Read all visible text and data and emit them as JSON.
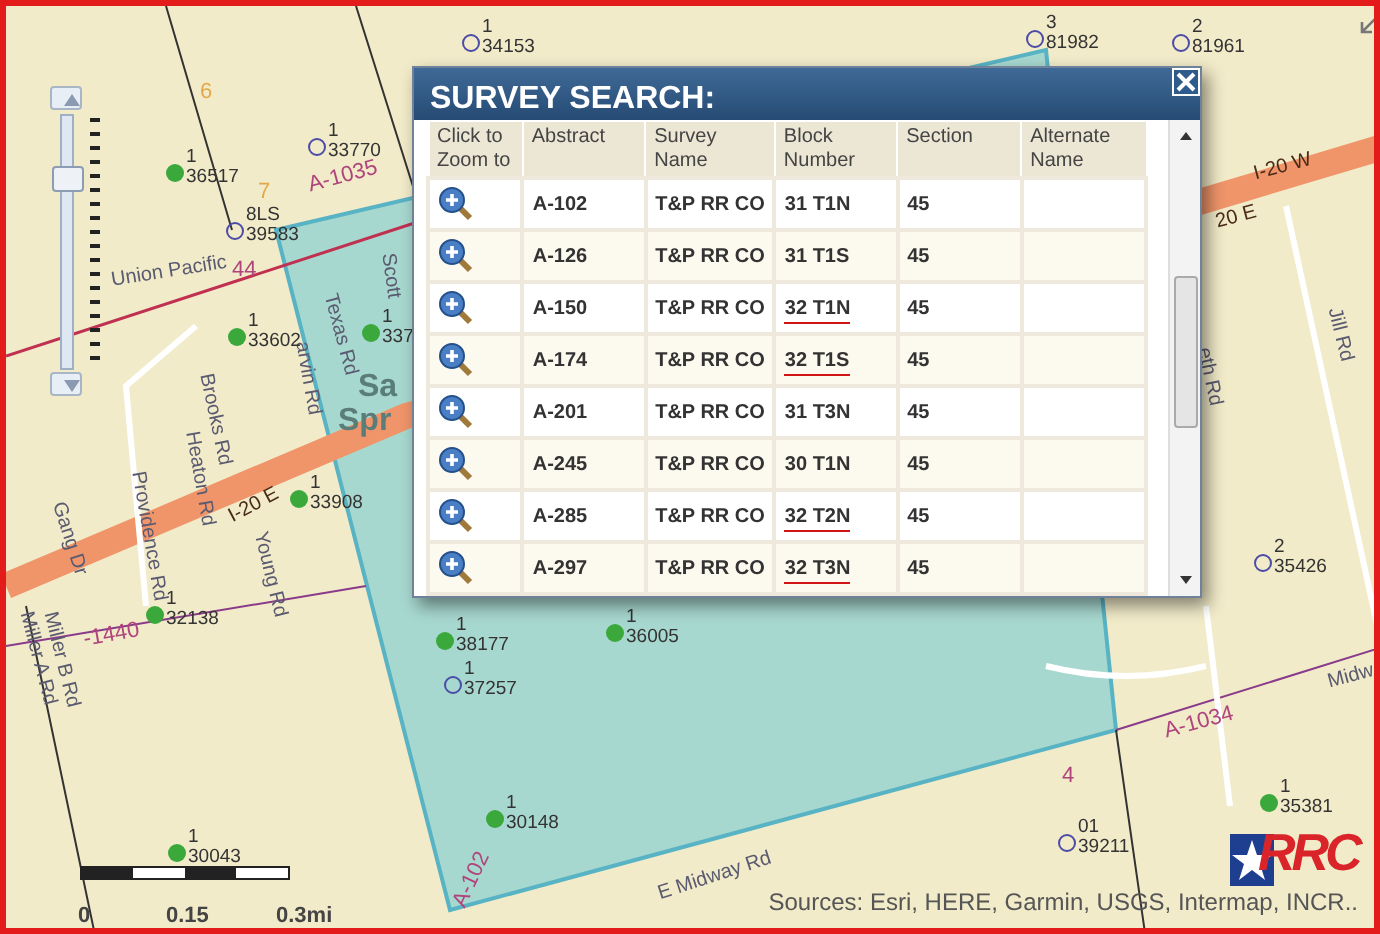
{
  "map": {
    "roads": [
      {
        "text": "Union Pacific"
      },
      {
        "text": "Providence Rd"
      },
      {
        "text": "Heaton Rd"
      },
      {
        "text": "Brooks Rd"
      },
      {
        "text": "Texas Rd"
      },
      {
        "text": "Scott"
      },
      {
        "text": "Gang Dr"
      },
      {
        "text": "Miller B Rd"
      },
      {
        "text": "Miller A Rd"
      },
      {
        "text": "Young Rd"
      },
      {
        "text": "I-20 E"
      },
      {
        "text": "I-20 W"
      },
      {
        "text": "20 E"
      },
      {
        "text": "Jill Rd"
      },
      {
        "text": "E Midway Rd"
      },
      {
        "text": "Midw"
      },
      {
        "text": "arvin Rd"
      },
      {
        "text": "eth Rd"
      }
    ],
    "places": [
      {
        "text": "Sa"
      },
      {
        "text": "Spr"
      }
    ],
    "tract_labels": [
      {
        "text": "A-1035",
        "kind": "abstract"
      },
      {
        "text": "A-1034",
        "kind": "abstract"
      },
      {
        "text": "-1440",
        "kind": "abstract"
      },
      {
        "text": "A-102",
        "kind": "abstract"
      },
      {
        "text": "44",
        "kind": "abstract"
      },
      {
        "text": "4",
        "kind": "abstract"
      },
      {
        "text": "6",
        "kind": "section"
      },
      {
        "text": "7",
        "kind": "section"
      }
    ],
    "wells": [
      {
        "kind": "producing",
        "number": "1",
        "id": "36517"
      },
      {
        "kind": "permit",
        "number": "1",
        "id": "33770"
      },
      {
        "kind": "permit",
        "number": "8LS",
        "id": "39583"
      },
      {
        "kind": "producing",
        "number": "1",
        "id": "33602"
      },
      {
        "kind": "producing",
        "number": "1",
        "id": "337"
      },
      {
        "kind": "producing",
        "number": "1",
        "id": "33908"
      },
      {
        "kind": "producing",
        "number": "1",
        "id": "32138"
      },
      {
        "kind": "producing",
        "number": "1",
        "id": "38177"
      },
      {
        "kind": "permit",
        "number": "1",
        "id": "37257"
      },
      {
        "kind": "producing",
        "number": "1",
        "id": "36005"
      },
      {
        "kind": "producing",
        "number": "1",
        "id": "30148"
      },
      {
        "kind": "producing",
        "number": "1",
        "id": "30043"
      },
      {
        "kind": "permit",
        "number": "01",
        "id": "39211"
      },
      {
        "kind": "producing",
        "number": "1",
        "id": "35381"
      },
      {
        "kind": "permit",
        "number": "2",
        "id": "35426"
      },
      {
        "kind": "permit",
        "number": "1",
        "id": "34153"
      },
      {
        "kind": "permit",
        "number": "3",
        "id": "81982"
      },
      {
        "kind": "permit",
        "number": "2",
        "id": "81961"
      }
    ],
    "zoom_slider": {
      "level": 0.78
    },
    "scale_bar": {
      "labels": [
        "0",
        "0.15",
        "0.3mi"
      ]
    },
    "attribution": "Sources: Esri, HERE, Garmin, USGS, Intermap, INCR..",
    "logo": {
      "text": "RRC"
    }
  },
  "dialog": {
    "title": "SURVEY SEARCH:",
    "columns": [
      "Click to Zoom to",
      "Abstract",
      "Survey Name",
      "Block Number",
      "Section",
      "Alternate Name"
    ],
    "rows": [
      {
        "abstract": "A-102",
        "survey_name": "T&P RR CO",
        "block_number": "31 T1N",
        "section": "45",
        "underlined": false
      },
      {
        "abstract": "A-126",
        "survey_name": "T&P RR CO",
        "block_number": "31 T1S",
        "section": "45",
        "underlined": false
      },
      {
        "abstract": "A-150",
        "survey_name": "T&P RR CO",
        "block_number": "32 T1N",
        "section": "45",
        "underlined": true
      },
      {
        "abstract": "A-174",
        "survey_name": "T&P RR CO",
        "block_number": "32 T1S",
        "section": "45",
        "underlined": true
      },
      {
        "abstract": "A-201",
        "survey_name": "T&P RR CO",
        "block_number": "31 T3N",
        "section": "45",
        "underlined": false
      },
      {
        "abstract": "A-245",
        "survey_name": "T&P RR CO",
        "block_number": "30 T1N",
        "section": "45",
        "underlined": false
      },
      {
        "abstract": "A-285",
        "survey_name": "T&P RR CO",
        "block_number": "32 T2N",
        "section": "45",
        "underlined": true
      },
      {
        "abstract": "A-297",
        "survey_name": "T&P RR CO",
        "block_number": "32 T3N",
        "section": "45",
        "underlined": true
      }
    ]
  }
}
